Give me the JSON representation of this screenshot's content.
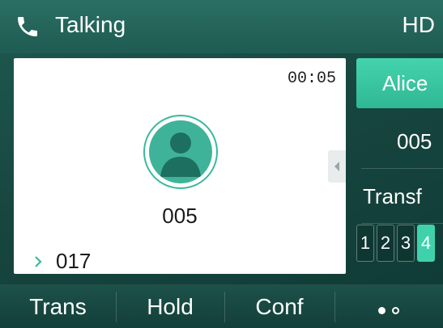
{
  "status_bar": {
    "state": "Talking",
    "hd_label": "HD",
    "icon": "phone-handset-icon"
  },
  "call": {
    "timer": "00:05",
    "remote_number": "005",
    "avatar_icon": "contact-avatar-icon",
    "second_call": {
      "icon": "chevron-right-icon",
      "number": "017"
    }
  },
  "dss_keys": {
    "items": [
      {
        "label": "Alice",
        "active": true
      },
      {
        "label": "005",
        "active": false
      },
      {
        "label": "Transf",
        "active": false
      }
    ],
    "pages": [
      {
        "label": "1"
      },
      {
        "label": "2"
      },
      {
        "label": "3"
      },
      {
        "label": "4"
      }
    ],
    "current_page": "4",
    "expand_icon": "chevron-left-icon"
  },
  "softkeys": {
    "trans": "Trans",
    "hold": "Hold",
    "conf": "Conf",
    "more_icon": "more-dots-icon"
  },
  "colors": {
    "accent": "#3fd1ab",
    "avatar": "#3fb39a",
    "background": "#17463f"
  }
}
